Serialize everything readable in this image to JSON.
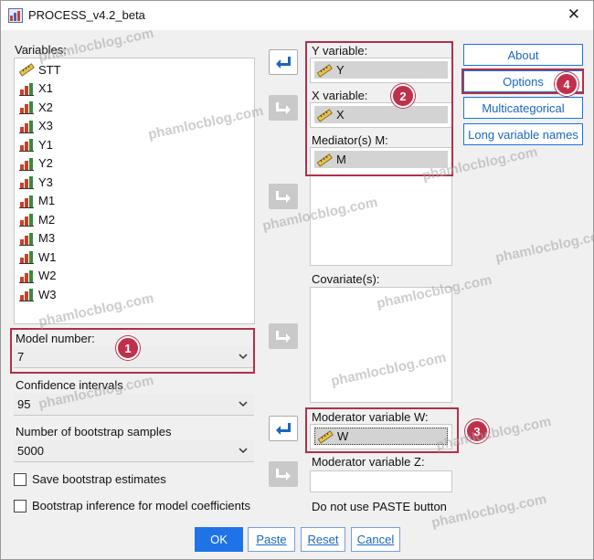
{
  "window": {
    "title": "PROCESS_v4.2_beta"
  },
  "variables": {
    "label": "Variables:",
    "items": [
      {
        "name": "STT",
        "icon": "ruler-icon"
      },
      {
        "name": "X1",
        "icon": "bar-chart-icon"
      },
      {
        "name": "X2",
        "icon": "bar-chart-icon"
      },
      {
        "name": "X3",
        "icon": "bar-chart-icon"
      },
      {
        "name": "Y1",
        "icon": "bar-chart-icon"
      },
      {
        "name": "Y2",
        "icon": "bar-chart-icon"
      },
      {
        "name": "Y3",
        "icon": "bar-chart-icon"
      },
      {
        "name": "M1",
        "icon": "bar-chart-icon"
      },
      {
        "name": "M2",
        "icon": "bar-chart-icon"
      },
      {
        "name": "M3",
        "icon": "bar-chart-icon"
      },
      {
        "name": "W1",
        "icon": "bar-chart-icon"
      },
      {
        "name": "W2",
        "icon": "bar-chart-icon"
      },
      {
        "name": "W3",
        "icon": "bar-chart-icon"
      }
    ]
  },
  "model_number": {
    "label": "Model number:",
    "value": "7"
  },
  "confidence": {
    "label": "Confidence intervals",
    "value": "95"
  },
  "bootstrap": {
    "label": "Number of bootstrap samples",
    "value": "5000"
  },
  "checkboxes": {
    "save_estimates": "Save bootstrap estimates",
    "bootstrap_inference": "Bootstrap inference for model coefficients"
  },
  "y_variable": {
    "label": "Y variable:",
    "value": "Y"
  },
  "x_variable": {
    "label": "X variable:",
    "value": "X"
  },
  "mediators": {
    "label": "Mediator(s) M:",
    "value": "M"
  },
  "covariates": {
    "label": "Covariate(s):"
  },
  "moderator_w": {
    "label": "Moderator variable W:",
    "value": "W"
  },
  "moderator_z": {
    "label": "Moderator variable Z:",
    "value": ""
  },
  "paste_note": "Do not use PASTE button",
  "side_buttons": {
    "about": "About",
    "options": "Options",
    "multicategorical": "Multicategorical",
    "long_names": "Long variable names"
  },
  "bottom_buttons": {
    "ok": "OK",
    "paste": "Paste",
    "reset": "Reset",
    "cancel": "Cancel"
  },
  "badges": [
    "1",
    "2",
    "3",
    "4"
  ],
  "watermark": "phamlocblog.com",
  "colors": {
    "highlight": "#b0304a",
    "badge": "#c0304a",
    "accent": "#1f73e6",
    "link": "#1a66c0"
  }
}
